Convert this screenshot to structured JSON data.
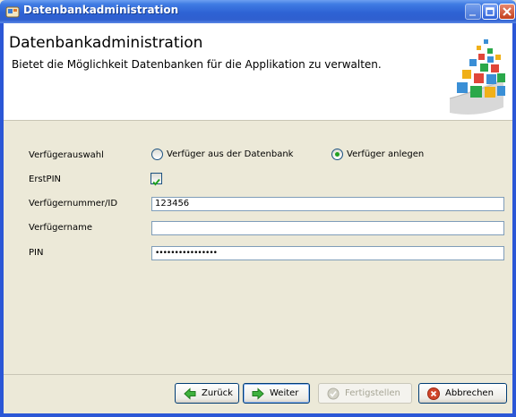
{
  "window": {
    "title": "Datenbankadministration"
  },
  "header": {
    "title": "Datenbankadministration",
    "description": "Bietet die Möglichkeit Datenbanken für die Applikation zu verwalten."
  },
  "form": {
    "verfuegerauswahl": {
      "label": "Verfügerauswahl",
      "options": [
        {
          "label": "Verfüger aus der Datenbank",
          "selected": false
        },
        {
          "label": "Verfüger anlegen",
          "selected": true
        }
      ]
    },
    "erstpin": {
      "label": "ErstPIN",
      "checked": true
    },
    "verfuegernummer": {
      "label": "Verfügernummer/ID",
      "value": "123456"
    },
    "verfuegername": {
      "label": "Verfügername",
      "value": ""
    },
    "pin": {
      "label": "PIN",
      "value": "••••••••••••••••"
    }
  },
  "buttons": {
    "back": "Zurück",
    "next": "Weiter",
    "finish": "Fertigstellen",
    "cancel": "Abbrechen"
  },
  "colors": {
    "titlebar": "#2e62d4",
    "accent_green": "#21a121",
    "cancel_red": "#d0452a"
  }
}
